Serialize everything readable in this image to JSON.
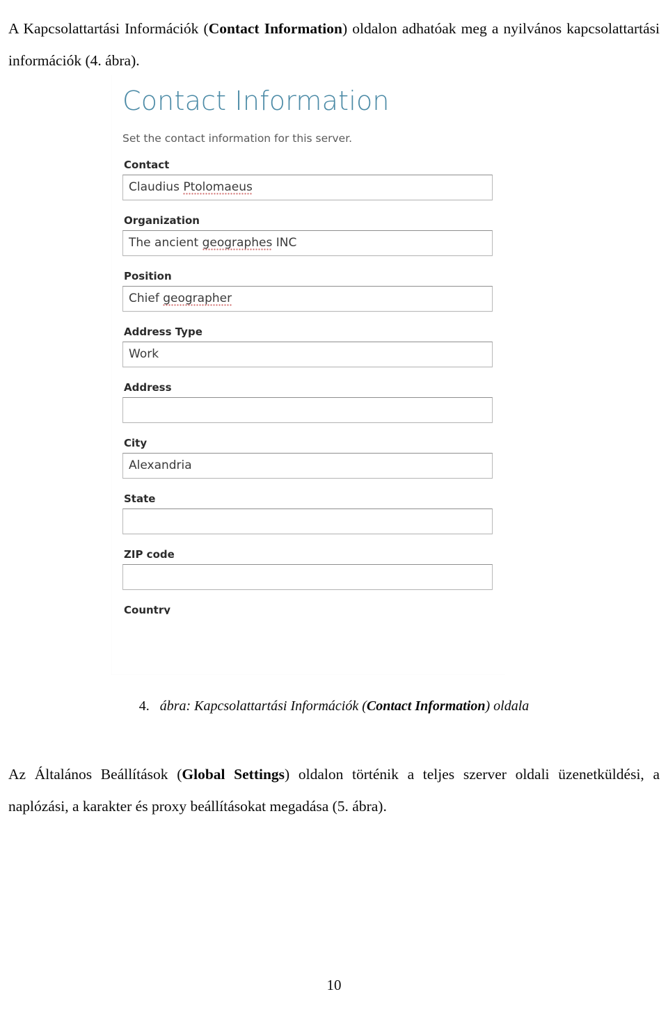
{
  "document": {
    "intro_paragraph": {
      "before_bold": "A Kapcsolattartási Információk (",
      "bold": "Contact Information",
      "after_bold": ") oldalon adhatóak meg a nyilvános kapcsolattartási információk (4. ábra)."
    },
    "figure_caption": {
      "number": "4.",
      "text_before_bold": "ábra: Kapcsolattartási Információk (",
      "bold": "Contact Information",
      "text_after_bold": ") oldala"
    },
    "closing_paragraph": {
      "before_bold": "Az Általános Beállítások (",
      "bold": "Global Settings",
      "after_bold": ") oldalon történik a teljes szerver oldali üzenetküldési, a naplózási, a karakter és proxy beállításokat megadása (5. ábra)."
    },
    "page_number": "10"
  },
  "screenshot": {
    "title": "Contact Information",
    "subtitle": "Set the contact information for this server.",
    "title_color": "#4b8aa6",
    "fields": [
      {
        "label": "Contact",
        "value": "Claudius Ptolomaeus",
        "spellchecked_word": "Ptolomaeus",
        "plain_prefix": "Claudius "
      },
      {
        "label": "Organization",
        "value": "The ancient geographes INC",
        "spellchecked_word": "geographes",
        "plain_prefix": "The ancient ",
        "plain_suffix": " INC"
      },
      {
        "label": "Position",
        "value": "Chief geographer",
        "spellchecked_word": "geographer",
        "plain_prefix": "Chief "
      },
      {
        "label": "Address Type",
        "value": "Work"
      },
      {
        "label": "Address",
        "value": ""
      },
      {
        "label": "City",
        "value": "Alexandria"
      },
      {
        "label": "State",
        "value": ""
      },
      {
        "label": "ZIP code",
        "value": ""
      }
    ],
    "clipped_field_label": "Country"
  }
}
